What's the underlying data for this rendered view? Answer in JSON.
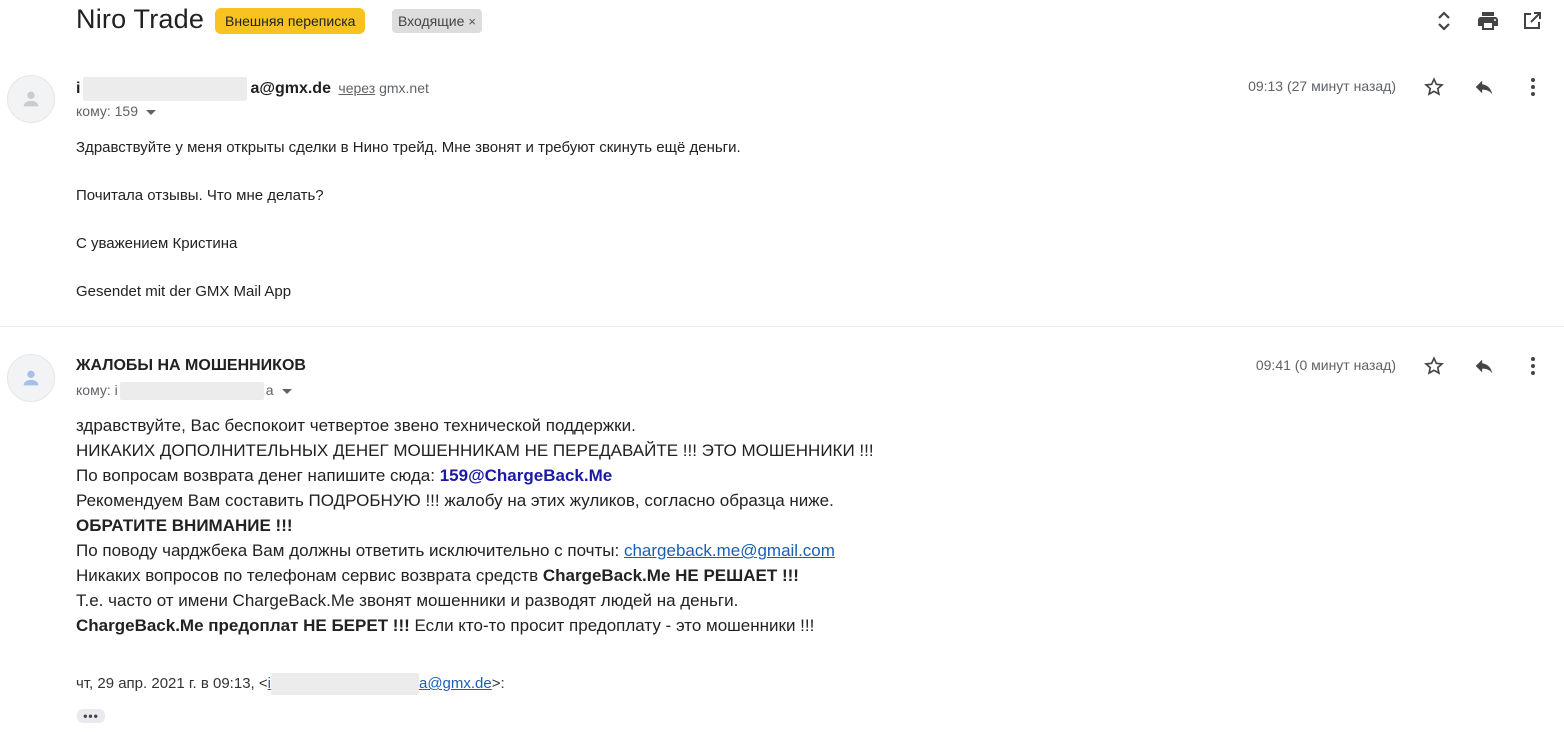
{
  "thread": {
    "subject": "Niro Trade",
    "labels": [
      {
        "text": "Внешняя переписка",
        "color": "#f8c220"
      },
      {
        "text": "Входящие",
        "color": "#dddddd",
        "remove": "×"
      }
    ],
    "top_icons": [
      "expand-collapse-icon",
      "print-icon",
      "open-in-new-window-icon"
    ]
  },
  "message1": {
    "sender_start": "i",
    "sender_end": "a@gmx.de",
    "via_word": "через",
    "via_domain": "gmx.net",
    "to_label": "кому: 159",
    "time": "09:13 (27 минут назад)",
    "body": [
      "Здравствуйте у меня открыты сделки в Нино трейд. Мне звонят и требуют скинуть ещё деньги.",
      "Почитала отзывы. Что мне делать?",
      "С уважением Кристина",
      "Gesendet mit der GMX Mail App"
    ]
  },
  "message2": {
    "sender": "ЖАЛОБЫ НА МОШЕННИКОВ",
    "to_label": "кому: i",
    "to_end": "a",
    "time": "09:41 (0 минут назад)",
    "line1": "здравствуйте, Вас беспокоит четвертое звено технической поддержки.",
    "line2": "НИКАКИХ ДОПОЛНИТЕЛЬНЫХ ДЕНЕГ МОШЕННИКАМ НЕ ПЕРЕДАВАЙТЕ !!! ЭТО МОШЕННИКИ !!!",
    "line3_text": "По вопросам возврата денег напишите сюда: ",
    "line3_link": "159@ChargeBack.Me",
    "line4": "Рекомендуем Вам составить ПОДРОБНУЮ !!! жалобу на этих жуликов, согласно образца ниже.",
    "line5": "ОБРАТИТЕ ВНИМАНИЕ !!!",
    "line6_text": "По поводу чарджбека Вам должны ответить исключительно с почты: ",
    "line6_link": "chargeback.me@gmail.com",
    "line7_text": "Никаких вопросов по телефонам сервис возврата средств ",
    "line7_bold": "ChargeBack.Me НЕ РЕШАЕТ !!!",
    "line8": "Т.е. часто от имени ChargeBack.Me звонят мошенники и разводят людей на деньги.",
    "line9_bold": "ChargeBack.Me предоплат НЕ БЕРЕТ !!!",
    "line9_text": " Если кто-то просит предоплату - это мошенники !!!",
    "quote_prefix": "чт, 29 апр. 2021 г. в 09:13, <",
    "quote_email_start": "i",
    "quote_email_end": "a@gmx.de",
    "quote_suffix": ">:",
    "show_trimmed": "•••"
  }
}
